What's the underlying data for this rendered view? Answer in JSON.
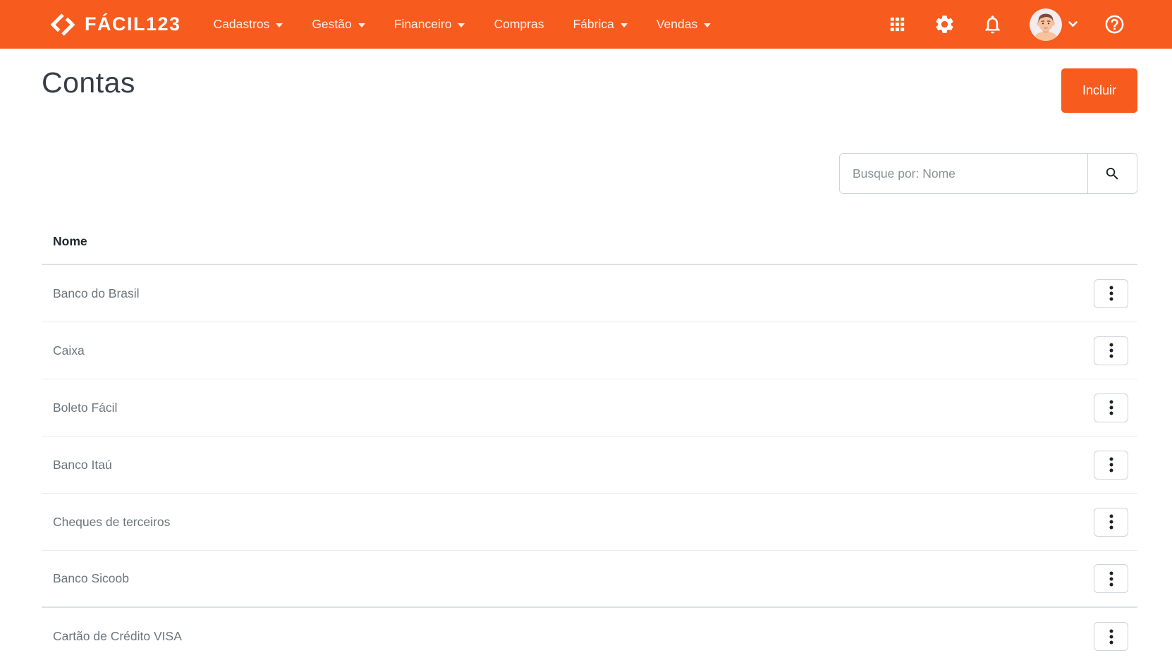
{
  "navbar": {
    "brand": "FÁCIL123",
    "items": [
      {
        "label": "Cadastros",
        "caret": true
      },
      {
        "label": "Gestão",
        "caret": true
      },
      {
        "label": "Financeiro",
        "caret": true
      },
      {
        "label": "Compras",
        "caret": false
      },
      {
        "label": "Fábrica",
        "caret": true
      },
      {
        "label": "Vendas",
        "caret": true
      }
    ],
    "action_icons": [
      "apps-grid-icon",
      "gear-icon",
      "bell-icon",
      "user-avatar",
      "chevron-down-icon",
      "help-icon"
    ]
  },
  "page": {
    "title": "Contas",
    "actions": {
      "include_label": "Incluir"
    },
    "search": {
      "placeholder": "Busque por: Nome",
      "icon": "search-icon"
    },
    "table": {
      "name_column": "Nome",
      "rows": [
        "Banco do Brasil",
        "Caixa",
        "Boleto Fácil",
        "Banco Itaú",
        "Cheques de terceiros",
        "Banco Sicoob",
        "Cartão de Crédito VISA"
      ],
      "row_action_icon": "kebab-menu-icon"
    }
  },
  "colors": {
    "primary": "#F75B1E",
    "title_text": "#353E47",
    "header_text": "#20262C",
    "row_text": "#6C757D",
    "border": "#CED3D9",
    "separator": "#E9EBEE",
    "separator_strong": "#DDE1E5"
  }
}
